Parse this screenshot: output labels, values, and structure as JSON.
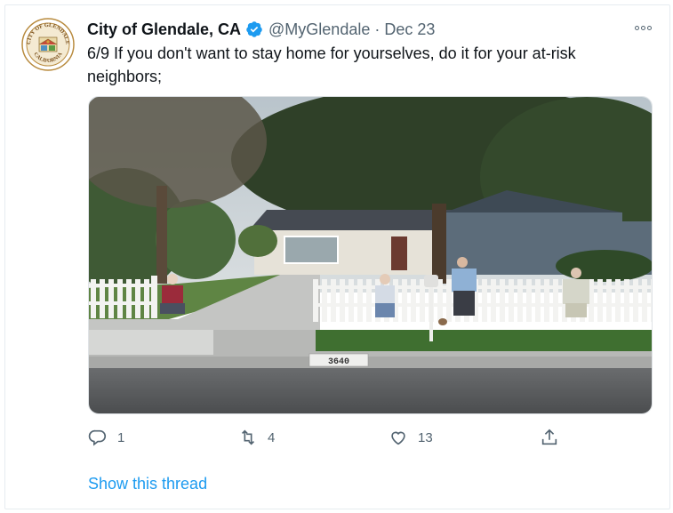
{
  "tweet": {
    "display_name": "City of Glendale, CA",
    "verified_icon": "verified-badge-icon",
    "handle": "@MyGlendale",
    "separator": "·",
    "date": "Dec 23",
    "text": "6/9 If you don't want to stay home for yourselves, do it for your at-risk neighbors;",
    "avatar_text": {
      "top": "CITY OF GLENDALE",
      "bottom": "CALIFORNIA"
    },
    "media": {
      "house_number": "3640"
    }
  },
  "actions": {
    "reply_count": "1",
    "retweet_count": "4",
    "like_count": "13"
  },
  "footer": {
    "show_thread": "Show this thread"
  },
  "colors": {
    "accent": "#1d9bf0",
    "secondary_text": "#536471",
    "border": "#e6ecf0"
  }
}
